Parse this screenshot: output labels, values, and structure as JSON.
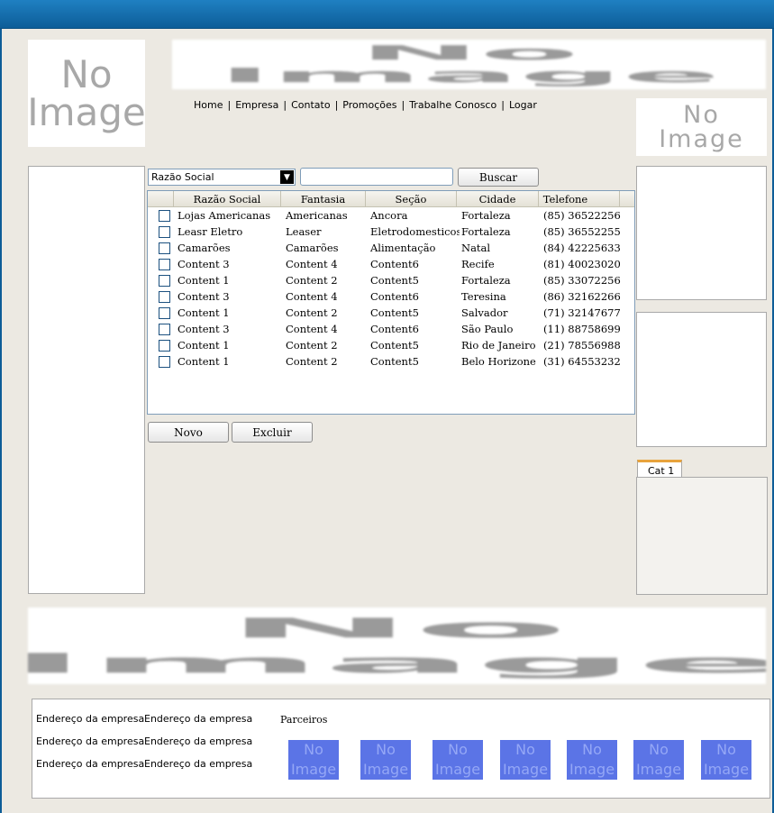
{
  "logo": {
    "line1": "No",
    "line2": "Image"
  },
  "banner_top": {
    "line1": "No",
    "line2": "Image"
  },
  "side_image": {
    "line1": "No",
    "line2": "Image"
  },
  "banner_bottom": {
    "line1": "No",
    "line2": "Image"
  },
  "nav": {
    "items": [
      "Home",
      "Empresa",
      "Contato",
      "Promoções",
      "Trabalhe Conosco",
      "Logar"
    ],
    "separator": "|"
  },
  "search": {
    "filter_selected": "Razão Social",
    "value": "",
    "button": "Buscar"
  },
  "table": {
    "columns": [
      "Razão Social",
      "Fantasia",
      "Seção",
      "Cidade",
      "Telefone"
    ],
    "rows": [
      [
        "Lojas Americanas",
        "Americanas",
        "Ancora",
        "Fortaleza",
        "(85) 36522256"
      ],
      [
        "Leasr Eletro",
        "Leaser",
        "Eletrodomesticos",
        "Fortaleza",
        "(85) 36552255"
      ],
      [
        "Camarões",
        "Camarões",
        "Alimentação",
        "Natal",
        "(84) 42225633"
      ],
      [
        "Content 3",
        "Content 4",
        "Content6",
        "Recife",
        "(81) 40023020"
      ],
      [
        "Content 1",
        "Content 2",
        "Content5",
        "Fortaleza",
        "(85) 33072256"
      ],
      [
        "Content 3",
        "Content 4",
        "Content6",
        "Teresina",
        "(86) 32162266"
      ],
      [
        "Content 1",
        "Content 2",
        "Content5",
        "Salvador",
        "(71) 32147677"
      ],
      [
        "Content 3",
        "Content 4",
        "Content6",
        "São Paulo",
        "(11) 88758699"
      ],
      [
        "Content 1",
        "Content 2",
        "Content5",
        "Rio de Janeiro",
        "(21) 78556988"
      ],
      [
        "Content 1",
        "Content 2",
        "Content5",
        "Belo Horizone",
        "(31) 64553232"
      ]
    ]
  },
  "actions": {
    "new": "Novo",
    "delete": "Excluir"
  },
  "tabs": {
    "items": [
      "Cat 1"
    ],
    "accent": "#e8a33c"
  },
  "footer": {
    "address_col1": [
      "Endereço da empresa",
      "Endereço da empresa",
      "Endereço da empresa"
    ],
    "address_col2": [
      "Endereço da empresa",
      "Endereço da empresa",
      "Endereço da empresa"
    ],
    "partners_label": "Parceiros",
    "partner_logo": {
      "line1": "No",
      "line2": "Image",
      "color": "#5b74e6"
    }
  },
  "colors": {
    "titlebar": "#1878ba",
    "background": "#ece9e2"
  }
}
